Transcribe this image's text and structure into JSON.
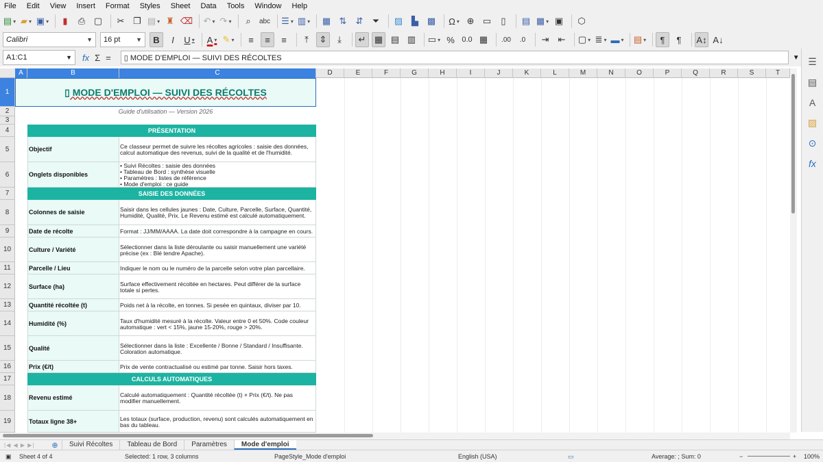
{
  "menu": [
    "File",
    "Edit",
    "View",
    "Insert",
    "Format",
    "Styles",
    "Sheet",
    "Data",
    "Tools",
    "Window",
    "Help"
  ],
  "toolbar": {
    "font_name": "Calibri",
    "font_size": "16 pt",
    "bold_label": "B",
    "italic_label": "I",
    "underline_label": "U",
    "font_color_label": "A",
    "percent_label": "%",
    "decimal_label": "0.0"
  },
  "formula": {
    "name_box": "A1:C1",
    "content": "▯ MODE D'EMPLOI — SUIVI DES RÉCOLTES",
    "fx_label": "fx",
    "sum_label": "Σ",
    "equals_label": "="
  },
  "columns": [
    "A",
    "B",
    "C",
    "D",
    "E",
    "F",
    "G",
    "H",
    "I",
    "J",
    "K",
    "L",
    "M",
    "N",
    "O",
    "P",
    "Q",
    "R",
    "S",
    "T"
  ],
  "rows": [
    "1",
    "2",
    "3",
    "4",
    "5",
    "6",
    "7",
    "8",
    "9",
    "10",
    "11",
    "12",
    "13",
    "14",
    "15",
    "16",
    "17",
    "18",
    "19"
  ],
  "sheet": {
    "title": "▯ MODE D'EMPLOI — SUIVI DES RÉCOLTES",
    "subtitle": "Guide d'utilisation — Version 2026",
    "sec_presentation": "PRÉSENTATION",
    "sec_saisie": "SAISIE DES DONNÉES",
    "sec_calculs": "CALCULS AUTOMATIQUES",
    "r5_label": "Objectif",
    "r5_desc": "Ce classeur permet de suivre les récoltes agricoles : saisie des données, calcul automatique des revenus, suivi de la qualité et de l'humidité.",
    "r6_label": "Onglets disponibles",
    "r6_desc": "• Suivi Récoltes : saisie des données\n• Tableau de Bord : synthèse visuelle\n• Paramètres : listes de référence\n• Mode d'emploi : ce guide",
    "r8_label": "Colonnes de saisie",
    "r8_desc": "Saisir dans les cellules jaunes : Date, Culture, Parcelle, Surface, Quantité, Humidité, Qualité, Prix. Le Revenu estimé est calculé automatiquement.",
    "r9_label": "Date de récolte",
    "r9_desc": "Format : JJ/MM/AAAA. La date doit correspondre à la campagne en cours.",
    "r10_label": "Culture / Variété",
    "r10_desc": "Sélectionner dans la liste déroulante ou saisir manuellement une variété précise (ex : Blé tendre Apache).",
    "r11_label": "Parcelle / Lieu",
    "r11_desc": "Indiquer le nom ou le numéro de la parcelle selon votre plan parcellaire.",
    "r12_label": "Surface (ha)",
    "r12_desc": "Surface effectivement récoltée en hectares. Peut différer de la surface totale si pertes.",
    "r13_label": "Quantité récoltée (t)",
    "r13_desc": "Poids net à la récolte, en tonnes. Si pesée en quintaux, diviser par 10.",
    "r14_label": "Humidité (%)",
    "r14_desc": "Taux d'humidité mesuré à la récolte. Valeur entre 0 et 50%. Code couleur automatique : vert < 15%, jaune 15-20%, rouge > 20%.",
    "r15_label": "Qualité",
    "r15_desc": "Sélectionner dans la liste : Excellente / Bonne / Standard / Insuffisante. Coloration automatique.",
    "r16_label": "Prix (€/t)",
    "r16_desc": "Prix de vente contractualisé ou estimé par tonne. Saisir hors taxes.",
    "r18_label": "Revenu estimé",
    "r18_desc": "Calculé automatiquement : Quantité récoltée (t) × Prix (€/t). Ne pas modifier manuellement.",
    "r19_label": "Totaux ligne 38+",
    "r19_desc": "Les totaux (surface, production, revenu) sont calculés automatiquement en bas du tableau."
  },
  "tabs": [
    "Suivi Récoltes",
    "Tableau de Bord",
    "Paramètres",
    "Mode d'emploi"
  ],
  "active_tab": "Mode d'emploi",
  "status": {
    "sheet": "Sheet 4 of 4",
    "selection": "Selected: 1 row, 3 columns",
    "page_style": "PageStyle_Mode d'emploi",
    "language": "English (USA)",
    "summary": "Average: ; Sum: 0",
    "zoom": "100%"
  },
  "colors": {
    "accent": "#1db3a2",
    "title_bg": "#e9faf7",
    "title_text": "#0b7a6b",
    "selection": "#3c82e0"
  }
}
